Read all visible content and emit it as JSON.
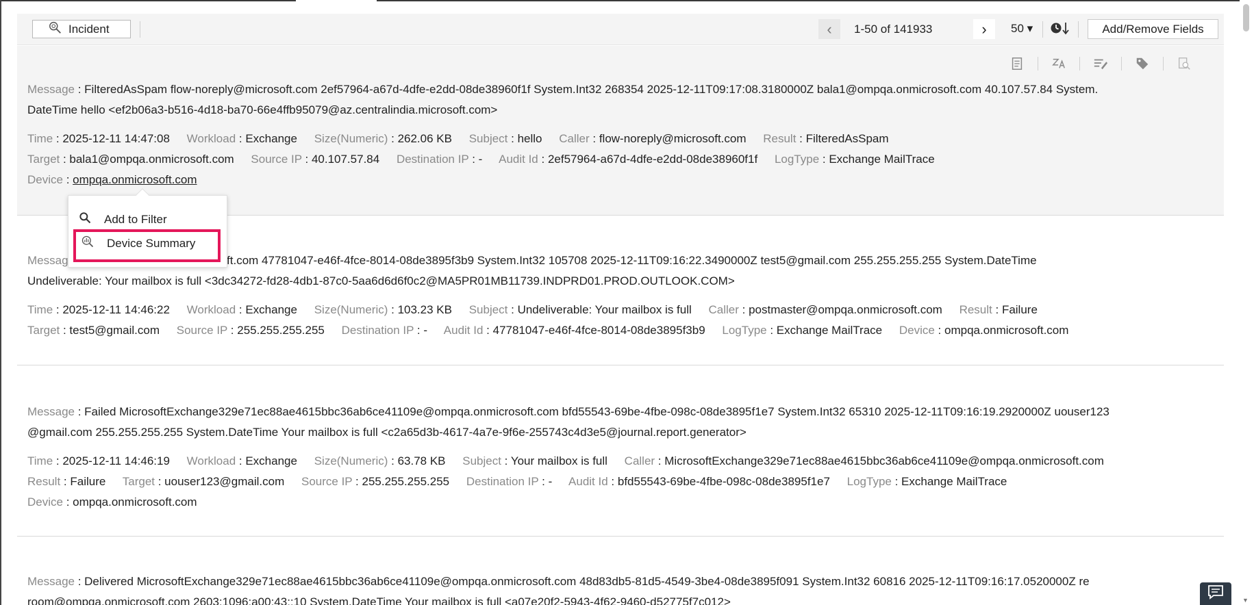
{
  "toolbar": {
    "incident_label": "Incident",
    "pagination_text": "1-50 of 141933",
    "per_page": "50 ▾",
    "sort_label": "🕒↓",
    "add_remove_fields": "Add/Remove Fields"
  },
  "labels": {
    "message": "Message",
    "time": "Time",
    "workload": "Workload",
    "size": "Size(Numeric)",
    "subject": "Subject",
    "caller": "Caller",
    "result": "Result",
    "target": "Target",
    "source_ip": "Source IP",
    "destination_ip": "Destination IP",
    "audit_id": "Audit Id",
    "logtype": "LogType",
    "device": "Device"
  },
  "records": [
    {
      "message_l1": "FilteredAsSpam flow-noreply@microsoft.com 2ef57964-a67d-4dfe-e2dd-08de38960f1f System.Int32 268354 2025-12-11T09:17:08.3180000Z bala1@ompqa.onmicrosoft.com 40.107.57.84 System.",
      "message_l2": "DateTime hello <ef2b06a3-b516-4d18-ba70-66e4ffb95079@az.centralindia.microsoft.com>",
      "time": "2025-12-11 14:47:08",
      "workload": "Exchange",
      "size": "262.06 KB",
      "subject": "hello",
      "caller": "flow-noreply@microsoft.com",
      "result": "FilteredAsSpam",
      "target": "bala1@ompqa.onmicrosoft.com",
      "source_ip": "40.107.57.84",
      "destination_ip": "-",
      "audit_id": "2ef57964-a67d-4dfe-e2dd-08de38960f1f",
      "logtype": "Exchange MailTrace",
      "device": "ompqa.onmicrosoft.com"
    },
    {
      "message_l1_visible": "qa.onmicrosoft.com 47781047-e46f-4fce-8014-08de3895f3b9 System.Int32 105708 2025-12-11T09:16:22.3490000Z test5@gmail.com 255.255.255.255 System.DateTime",
      "message_l2": "Undeliverable: Your mailbox is full <3dc34272-fd28-4db1-87c0-5aa6d6d6f0c2@MA5PR01MB11739.INDPRD01.PROD.OUTLOOK.COM>",
      "time": "2025-12-11 14:46:22",
      "workload": "Exchange",
      "size": "103.23 KB",
      "subject": "Undeliverable: Your mailbox is full",
      "caller": "postmaster@ompqa.onmicrosoft.com",
      "result": "Failure",
      "target": "test5@gmail.com",
      "source_ip": "255.255.255.255",
      "destination_ip": "-",
      "audit_id": "47781047-e46f-4fce-8014-08de3895f3b9",
      "logtype": "Exchange MailTrace",
      "device": "ompqa.onmicrosoft.com"
    },
    {
      "message_l1": "Failed MicrosoftExchange329e71ec88ae4615bbc36ab6ce41109e@ompqa.onmicrosoft.com bfd55543-69be-4fbe-098c-08de3895f1e7 System.Int32 65310 2025-12-11T09:16:19.2920000Z uouser123",
      "message_l2": "@gmail.com 255.255.255.255 System.DateTime Your mailbox is full <c2a65d3b-4617-4a7e-9f6e-255743c4d3e5@journal.report.generator>",
      "time": "2025-12-11 14:46:19",
      "workload": "Exchange",
      "size": "63.78 KB",
      "subject": "Your mailbox is full",
      "caller": "MicrosoftExchange329e71ec88ae4615bbc36ab6ce41109e@ompqa.onmicrosoft.com",
      "result": "Failure",
      "target": "uouser123@gmail.com",
      "source_ip": "255.255.255.255",
      "destination_ip": "-",
      "audit_id": "bfd55543-69be-4fbe-098c-08de3895f1e7",
      "logtype": "Exchange MailTrace",
      "device": "ompqa.onmicrosoft.com"
    },
    {
      "message_l1": "Delivered MicrosoftExchange329e71ec88ae4615bbc36ab6ce41109e@ompqa.onmicrosoft.com 48d83db5-81d5-4549-3be4-08de3895f091 System.Int32 60816 2025-12-11T09:16:17.0520000Z re",
      "message_l2": "room@ompqa.onmicrosoft.com 2603:1096:a00:43::10 System.DateTime Your mailbox is full <a07e20f2-5943-4f62-9460-d52775f7c012>"
    }
  ],
  "popup": {
    "add_to_filter": "Add to Filter",
    "device_summary": "Device Summary"
  }
}
